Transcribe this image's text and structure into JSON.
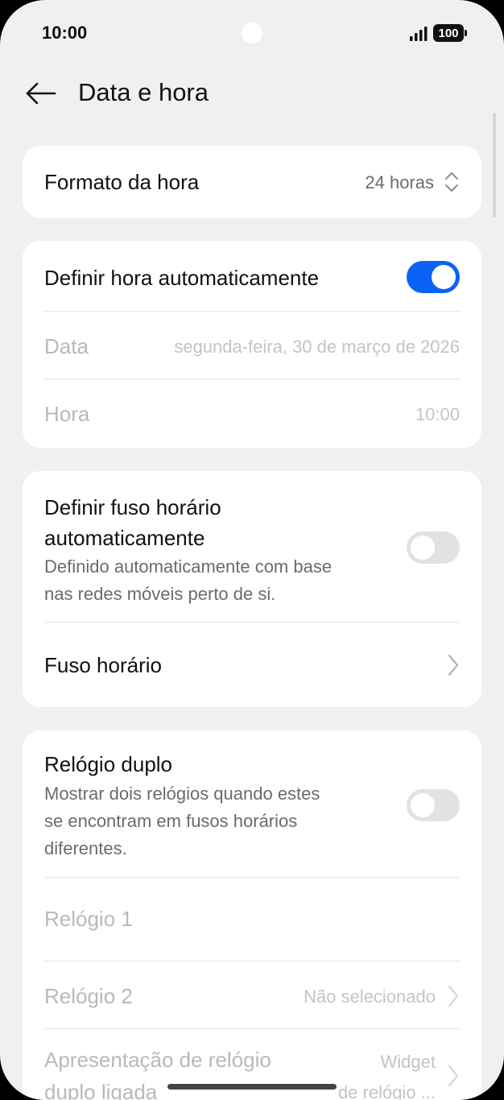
{
  "status_bar": {
    "time": "10:00",
    "battery": "100",
    "icons": [
      "signal-icon",
      "battery-icon"
    ]
  },
  "header": {
    "title": "Data e hora",
    "back_icon": "arrow-left-icon"
  },
  "time_format": {
    "label": "Formato da hora",
    "value": "24 horas",
    "icon": "chevron-up-down-icon"
  },
  "auto_time": {
    "label": "Definir hora automaticamente",
    "enabled": true,
    "date_label": "Data",
    "date_value": "segunda-feira, 30 de março de 2026",
    "time_label": "Hora",
    "time_value": "10:00"
  },
  "timezone": {
    "auto_label_line1": "Definir fuso horário",
    "auto_label_line2": "automaticamente",
    "auto_sub_line1": "Definido automaticamente com base",
    "auto_sub_line2": "nas redes móveis perto de si.",
    "auto_enabled": false,
    "zone_label": "Fuso horário"
  },
  "dual_clock": {
    "label": "Relógio duplo",
    "sub_line1": "Mostrar dois relógios quando estes",
    "sub_line2": "se encontram em fusos horários",
    "sub_line3": "diferentes.",
    "enabled": false,
    "clock1_label": "Relógio 1",
    "clock2_label": "Relógio 2",
    "clock2_value": "Não selecionado",
    "display_label_line1": "Apresentação de relógio",
    "display_label_line2": "duplo ligada",
    "display_value_line1": "Widget",
    "display_value_line2": "de relógio ..."
  },
  "colors": {
    "accent": "#0a63f6",
    "background": "#f0f0f2",
    "card": "#ffffff"
  }
}
